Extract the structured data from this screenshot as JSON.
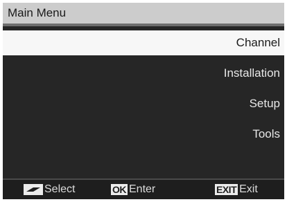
{
  "title": "Main Menu",
  "menu": {
    "items": [
      {
        "label": "Channel",
        "selected": true
      },
      {
        "label": "Installation",
        "selected": false
      },
      {
        "label": "Setup",
        "selected": false
      },
      {
        "label": "Tools",
        "selected": false
      }
    ]
  },
  "footer": {
    "select": {
      "key_icon": "up-down-arrows-icon",
      "label": "Select"
    },
    "enter": {
      "key": "OK",
      "label": "Enter"
    },
    "exit": {
      "key": "EXIT",
      "label": "Exit"
    }
  },
  "colors": {
    "title_bar": "#cccccc",
    "panel": "#262626",
    "selected_row": "#f7f7f7"
  }
}
